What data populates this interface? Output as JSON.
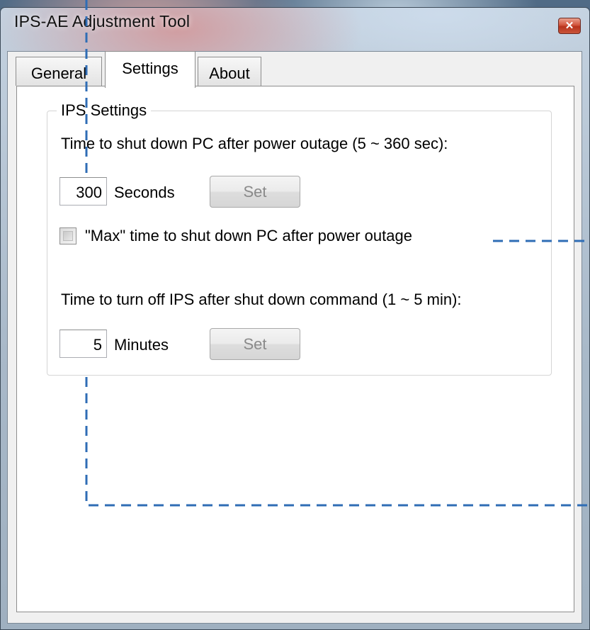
{
  "window": {
    "title": "IPS-AE Adjustment Tool",
    "close_glyph": "✕"
  },
  "tabs": [
    {
      "label": "General",
      "selected": false
    },
    {
      "label": "Settings",
      "selected": true
    },
    {
      "label": "About",
      "selected": false
    }
  ],
  "group": {
    "title": "IPS Settings"
  },
  "shutdown": {
    "label": "Time to shut down PC after power outage (5 ~ 360 sec):",
    "value": "300",
    "unit": "Seconds",
    "set_label": "Set"
  },
  "max_option": {
    "label": "\"Max\" time to shut down PC after power outage",
    "checked": false
  },
  "turnoff": {
    "label": "Time to turn off IPS after shut down command (1 ~ 5 min):",
    "value": "5",
    "unit": "Minutes",
    "set_label": "Set"
  },
  "colors": {
    "callout_line": "#2f6db5",
    "close_button": "#c9452c"
  }
}
